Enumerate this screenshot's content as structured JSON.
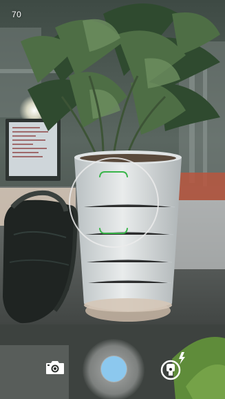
{
  "camera": {
    "frame_counter": "70",
    "focus_indicator_color": "#39b54a",
    "shutter_color": "#8cc8ee"
  },
  "controls": {
    "switch_camera_icon": "camera-switch-icon",
    "shutter_icon": "shutter-button",
    "flash_icon": "flash-auto-icon"
  }
}
